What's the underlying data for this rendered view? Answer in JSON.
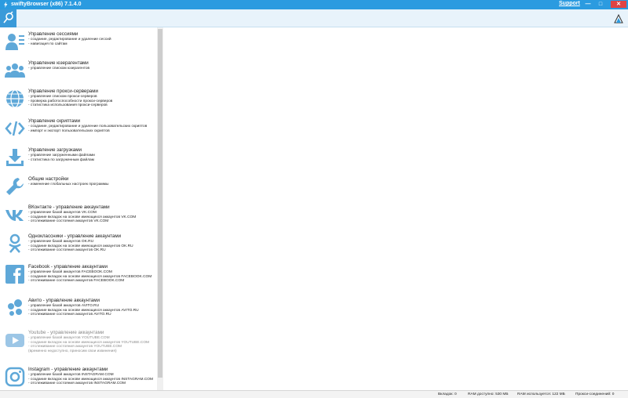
{
  "window": {
    "title": "swiftyBrowser (x86) 7.1.4.0",
    "support": "Support",
    "minimize": "—",
    "maximize": "□",
    "close": "✕"
  },
  "colors": {
    "accent": "#2b9be0",
    "icon": "#5fa8d8"
  },
  "sidebar": {
    "items": [
      {
        "icon": "users-manage-icon",
        "name": "Управление сессиями",
        "lines": [
          "- создание, редактирование и удаление сессий",
          "- навигация по сайтам"
        ]
      },
      {
        "icon": "user-agents-icon",
        "name": "Управление юзерагентами",
        "lines": [
          "- управление списком юзерагентов"
        ]
      },
      {
        "icon": "globe-icon",
        "name": "Управление прокси-серверами",
        "lines": [
          "- управление списком прокси-серверов",
          "- проверка работоспособности прокси-серверов",
          "- статистика использования прокси-серверов"
        ]
      },
      {
        "icon": "code-icon",
        "name": "Управление скриптами",
        "lines": [
          "- создание, редактирование и удаление пользовательских скриптов",
          "- импорт и экспорт пользовательских скриптов"
        ]
      },
      {
        "icon": "download-icon",
        "name": "Управление загрузками",
        "lines": [
          "- управление загруженными файлами",
          "- статистика по загруженным файлам"
        ]
      },
      {
        "icon": "wrench-icon",
        "name": "Общие настройки",
        "lines": [
          "- изменение глобальных настроек программы"
        ]
      },
      {
        "icon": "vk-icon",
        "name": "ВКонтакте - управление аккаунтами",
        "lines": [
          "- управление базой аккаунтов VK.COM",
          "- создание вкладок на основе имеющихся аккаунтов VK.COM",
          "- отслеживание состояния аккаунтов VK.COM"
        ]
      },
      {
        "icon": "odnoklassniki-icon",
        "name": "Одноклассники - управление аккаунтами",
        "lines": [
          "- управление базой аккаунтов OK.RU",
          "- создание вкладок на основе имеющихся аккаунтов OK.RU",
          "- отслеживание состояния аккаунтов OK.RU"
        ]
      },
      {
        "icon": "facebook-icon",
        "name": "Facebook - управление аккаунтами",
        "lines": [
          "- управление базой аккаунтов FACEBOOK.COM",
          "- создание вкладок на основе имеющихся аккаунтов FACEBOOK.COM",
          "- отслеживание состояния аккаунтов FACEBOOK.COM"
        ]
      },
      {
        "icon": "avito-icon",
        "name": "Авито - управление аккаунтами",
        "lines": [
          "- управление базой аккаунтов AVITO.RU",
          "- создание вкладок на основе имеющихся аккаунтов AVITO.RU",
          "- отслеживание состояния аккаунтов AVITO.RU"
        ]
      },
      {
        "icon": "youtube-icon",
        "name": "Youtube - управление аккаунтами",
        "lines": [
          "- управление базой аккаунтов YOUTUBE.COM",
          "- создание вкладок на основе имеющихся аккаунтов YOUTUBE.COM",
          "- отслеживание состояния аккаунтов YOUTUBE.COM",
          "(временно недоступно, приносим свои извинения)"
        ],
        "disabled": true
      },
      {
        "icon": "instagram-icon",
        "name": "Instagram - управление аккаунтами",
        "lines": [
          "- управление базой аккаунтов INSTAGRAM.COM",
          "- создание вкладок на основе имеющихся аккаунтов INSTAGRAM.COM",
          "- отслеживание состояния аккаунтов INSTAGRAM.COM"
        ]
      }
    ]
  },
  "status": {
    "tabs": "Вкладок: 0",
    "ram_free": "RAM доступно: 530 МБ",
    "ram_used": "RAM используется: 122 МБ",
    "proxy": "Прокси-соединений: 0"
  }
}
